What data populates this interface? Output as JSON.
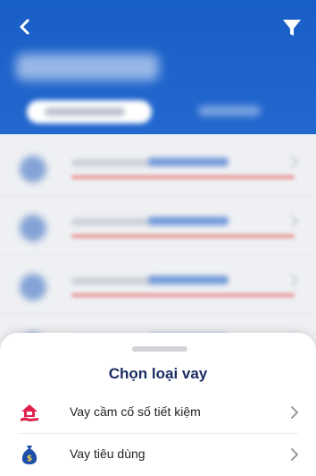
{
  "header": {
    "back_icon": "chevron-left-icon",
    "filter_icon": "filter-funnel-icon",
    "background_color": "#0c56c4"
  },
  "sheet": {
    "title": "Chọn loại vay",
    "options": [
      {
        "label": "Vay cầm cố số tiết kiệm",
        "icon": "house-hand-icon",
        "icon_color": "#e0234e"
      },
      {
        "label": "Vay tiêu dùng",
        "icon": "money-bag-icon",
        "icon_color": "#1d4fa8"
      }
    ]
  }
}
